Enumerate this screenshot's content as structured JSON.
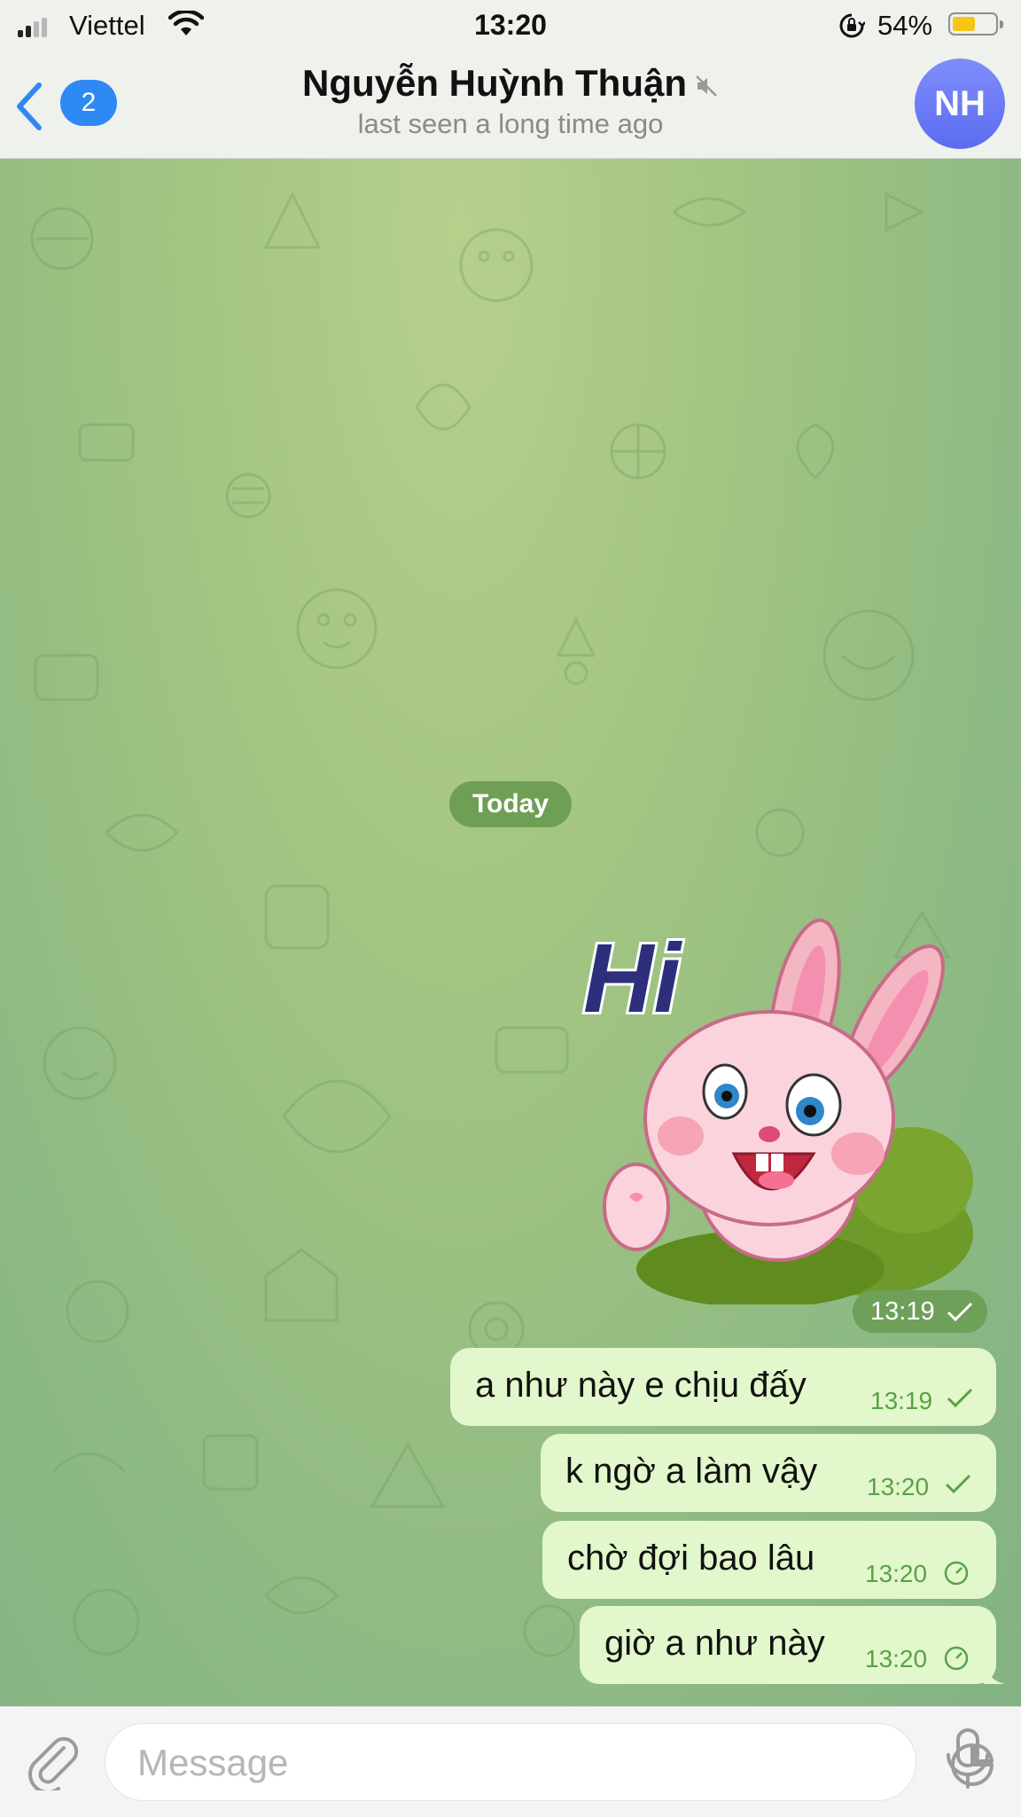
{
  "status_bar": {
    "carrier": "Viettel",
    "time": "13:20",
    "battery_percent": "54%",
    "battery_level": 0.54,
    "signal_bars": 2,
    "icons": [
      "signal-icon",
      "wifi-icon",
      "orientation-lock-icon",
      "battery-icon"
    ]
  },
  "header": {
    "back_badge": "2",
    "title": "Nguyễn Huỳnh Thuận",
    "subtitle": "last seen a long time ago",
    "avatar_initials": "NH",
    "muted_icon": "mute-icon",
    "accent_color": "#2f89f5"
  },
  "chat": {
    "date_label": "Today",
    "sticker": {
      "text": "Hi",
      "time": "13:19",
      "status": "sent-check"
    },
    "messages": [
      {
        "text": "a như này e chịu đấy",
        "time": "13:19",
        "status": "sent-check"
      },
      {
        "text": "k ngờ a làm vậy",
        "time": "13:20",
        "status": "sent-check"
      },
      {
        "text": "chờ đợi bao lâu",
        "time": "13:20",
        "status": "pending-clock"
      },
      {
        "text": "giờ a như này",
        "time": "13:20",
        "status": "pending-clock"
      }
    ],
    "bubble_color": "#e2f7cb",
    "time_color": "#5aa146"
  },
  "input": {
    "placeholder": "Message",
    "value": "",
    "icons": [
      "paperclip-icon",
      "sticker-icon",
      "microphone-icon"
    ]
  }
}
